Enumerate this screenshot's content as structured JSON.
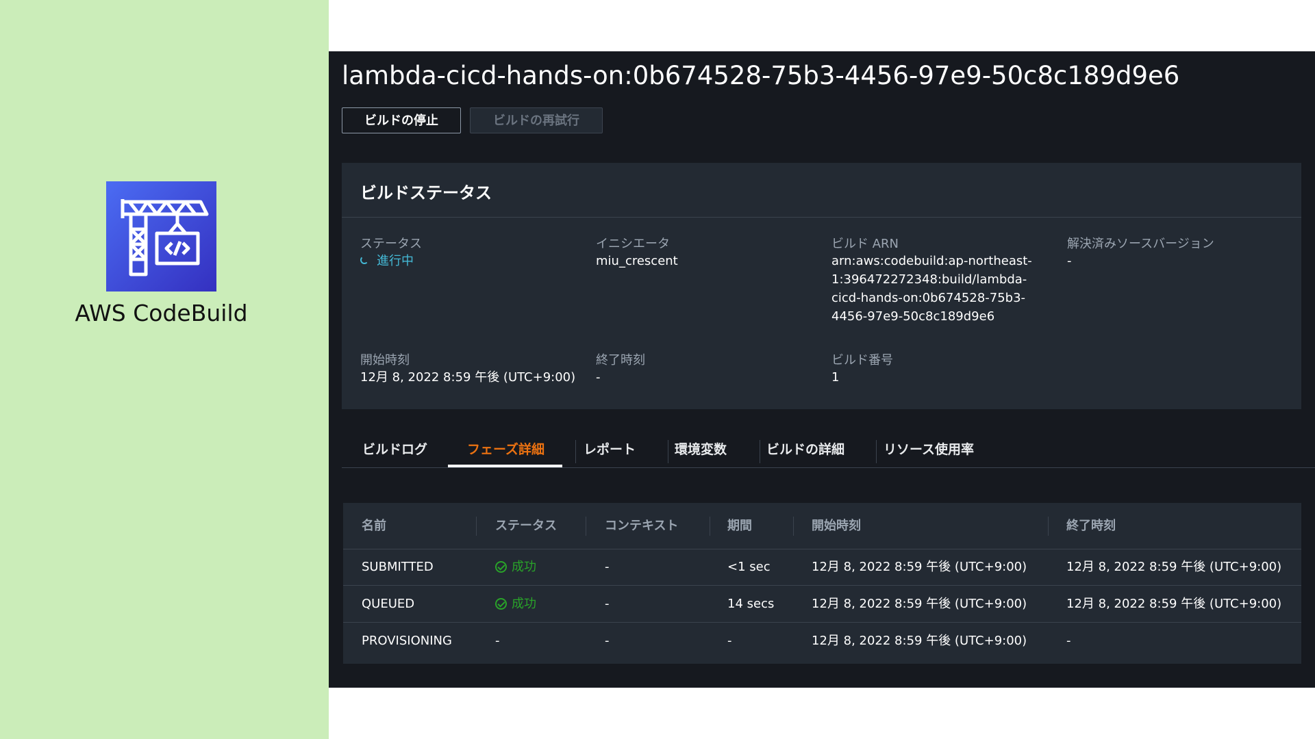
{
  "brand": {
    "name": "AWS CodeBuild",
    "icon": "codebuild-crane-icon",
    "colors": {
      "gradient_start": "#4b6cf3",
      "gradient_end": "#3430c0",
      "background": "#cbedb9"
    }
  },
  "page": {
    "title": "lambda-cicd-hands-on:0b674528-75b3-4456-97e9-50c8c189d9e6"
  },
  "actions": {
    "stop_label": "ビルドの停止",
    "retry_label": "ビルドの再試行"
  },
  "status_panel": {
    "title": "ビルドステータス",
    "fields": {
      "status": {
        "label": "ステータス",
        "value": "進行中"
      },
      "initiator": {
        "label": "イニシエータ",
        "value": "miu_crescent"
      },
      "build_arn": {
        "label": "ビルド ARN",
        "lines": [
          "arn:aws:codebuild:ap-northeast-",
          "1:396472272348:build/lambda-",
          "cicd-hands-on:0b674528-75b3-",
          "4456-97e9-50c8c189d9e6"
        ]
      },
      "resolved_source": {
        "label": "解決済みソースバージョン",
        "value": "-"
      },
      "start_time": {
        "label": "開始時刻",
        "value": "12月 8, 2022 8:59 午後 (UTC+9:00)"
      },
      "end_time": {
        "label": "終了時刻",
        "value": "-"
      },
      "build_number": {
        "label": "ビルド番号",
        "value": "1"
      }
    }
  },
  "tabs": [
    {
      "label": "ビルドログ",
      "active": false
    },
    {
      "label": "フェーズ詳細",
      "active": true
    },
    {
      "label": "レポート",
      "active": false
    },
    {
      "label": "環境変数",
      "active": false
    },
    {
      "label": "ビルドの詳細",
      "active": false
    },
    {
      "label": "リソース使用率",
      "active": false
    }
  ],
  "phases_table": {
    "columns": [
      "名前",
      "ステータス",
      "コンテキスト",
      "期間",
      "開始時刻",
      "終了時刻"
    ],
    "rows": [
      {
        "name": "SUBMITTED",
        "status": "成功",
        "context": "-",
        "duration": "<1 sec",
        "start": "12月 8, 2022 8:59 午後 (UTC+9:00)",
        "end": "12月 8, 2022 8:59 午後 (UTC+9:00)"
      },
      {
        "name": "QUEUED",
        "status": "成功",
        "context": "-",
        "duration": "14 secs",
        "start": "12月 8, 2022 8:59 午後 (UTC+9:00)",
        "end": "12月 8, 2022 8:59 午後 (UTC+9:00)"
      },
      {
        "name": "PROVISIONING",
        "status": "-",
        "context": "-",
        "duration": "-",
        "start": "12月 8, 2022 8:59 午後 (UTC+9:00)",
        "end": "-"
      }
    ]
  },
  "colors": {
    "accent": "#ec7211",
    "success": "#29a329",
    "in_progress": "#44b9d6",
    "console_bg": "#16191f",
    "panel_bg": "#232a33"
  }
}
